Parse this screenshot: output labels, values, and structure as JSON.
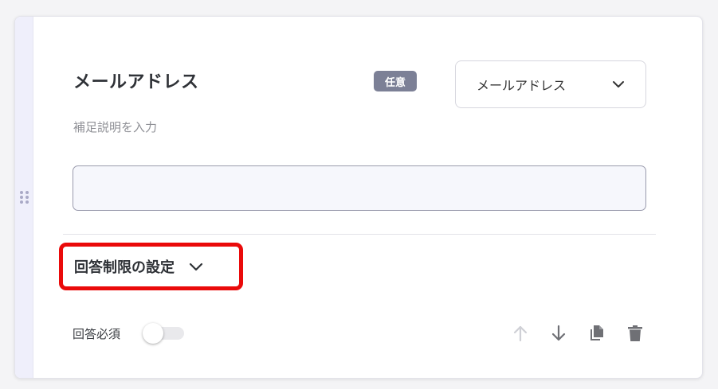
{
  "question": {
    "title": "メールアドレス",
    "badge": "任意",
    "description_placeholder": "補足説明を入力",
    "answer_value": ""
  },
  "type_select": {
    "value": "メールアドレス",
    "icon": "chevron-down-icon"
  },
  "restriction": {
    "label": "回答制限の設定",
    "icon": "chevron-down-icon",
    "highlight_color": "#ea0a0a"
  },
  "footer": {
    "required_label": "回答必須",
    "required_on": false,
    "actions": [
      "arrow-up-icon",
      "arrow-down-icon",
      "copy-icon",
      "trash-icon"
    ]
  },
  "colors": {
    "badge_bg": "#7c8096",
    "drag_strip": "#efeffb",
    "input_bg": "#f6f7fc"
  }
}
